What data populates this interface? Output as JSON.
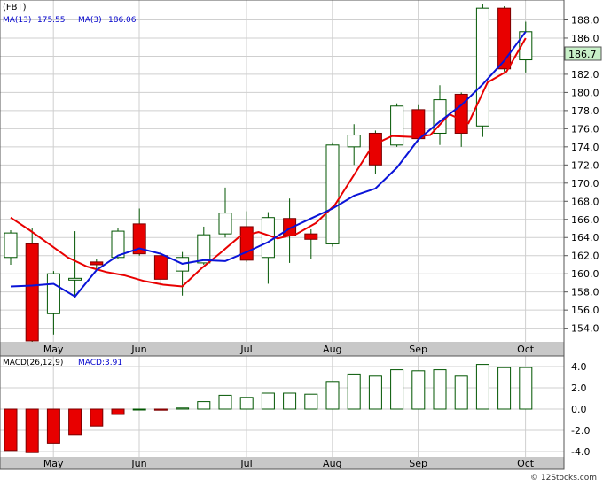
{
  "header": {
    "ticker": "(FBT)",
    "ma13_label": "MA(13)",
    "ma13_value": "175.55",
    "ma3_label": "MA(3)",
    "ma3_value": "186.06",
    "current_price": "186.7"
  },
  "macd_header": {
    "label": "MACD(26,12,9)",
    "value_label": "MACD:3.91"
  },
  "watermark": "© 12Stocks.com",
  "colors": {
    "up_candle": "#ffffff",
    "down_candle": "#e80000",
    "candle_border": "#005500",
    "ma_short": "#e80000",
    "ma_long": "#0a14d8",
    "macd_bar": "#005500",
    "axis_band": "#c8c8c8",
    "grid": "#cfcfcf",
    "price_badge": "#c8f0c8"
  },
  "chart_data": [
    {
      "type": "candlestick",
      "title": "",
      "x_labels": [
        "May",
        "Jun",
        "Jul",
        "Aug",
        "Sep",
        "Oct"
      ],
      "x_label_at_index": [
        1,
        5,
        10,
        14,
        18,
        23
      ],
      "ylim": [
        152.5,
        190
      ],
      "y_ticks": [
        "154.0",
        "156.0",
        "158.0",
        "160.0",
        "162.0",
        "164.0",
        "166.0",
        "168.0",
        "170.0",
        "172.0",
        "174.0",
        "176.0",
        "178.0",
        "180.0",
        "182.0",
        "184.0",
        "186.0",
        "188.0"
      ],
      "grid": true,
      "candles": [
        {
          "open": 161.8,
          "high": 164.8,
          "low": 161.0,
          "close": 164.5
        },
        {
          "open": 163.3,
          "high": 165.0,
          "low": 152.5,
          "close": 152.6
        },
        {
          "open": 155.6,
          "high": 160.3,
          "low": 153.3,
          "close": 160.0
        },
        {
          "open": 159.5,
          "high": 164.7,
          "low": 157.3,
          "close": 159.5
        },
        {
          "open": 161.3,
          "high": 161.6,
          "low": 160.3,
          "close": 161.0
        },
        {
          "open": 161.8,
          "high": 165.0,
          "low": 161.6,
          "close": 164.7
        },
        {
          "open": 165.5,
          "high": 167.2,
          "low": 162.0,
          "close": 162.2
        },
        {
          "open": 162.0,
          "high": 162.5,
          "low": 158.4,
          "close": 159.4
        },
        {
          "open": 160.3,
          "high": 162.4,
          "low": 157.6,
          "close": 161.8
        },
        {
          "open": 161.2,
          "high": 165.2,
          "low": 161.0,
          "close": 164.3
        },
        {
          "open": 164.4,
          "high": 169.5,
          "low": 164.0,
          "close": 166.7
        },
        {
          "open": 165.2,
          "high": 166.9,
          "low": 161.3,
          "close": 161.5
        },
        {
          "open": 161.8,
          "high": 166.8,
          "low": 158.9,
          "close": 166.2
        },
        {
          "open": 166.1,
          "high": 168.3,
          "low": 161.2,
          "close": 164.2
        },
        {
          "open": 164.4,
          "high": 164.9,
          "low": 161.6,
          "close": 163.8
        },
        {
          "open": 163.3,
          "high": 174.5,
          "low": 163.0,
          "close": 174.2
        },
        {
          "open": 174.0,
          "high": 176.5,
          "low": 172.0,
          "close": 175.3
        },
        {
          "open": 175.5,
          "high": 175.8,
          "low": 171.0,
          "close": 172.0
        },
        {
          "open": 174.2,
          "high": 178.8,
          "low": 174.0,
          "close": 178.5
        },
        {
          "open": 178.1,
          "high": 178.6,
          "low": 174.6,
          "close": 174.9
        },
        {
          "open": 175.5,
          "high": 180.8,
          "low": 174.2,
          "close": 179.2
        },
        {
          "open": 179.8,
          "high": 180.0,
          "low": 174.0,
          "close": 175.5
        },
        {
          "open": 176.3,
          "high": 189.8,
          "low": 175.1,
          "close": 189.3
        },
        {
          "open": 189.3,
          "high": 189.5,
          "low": 182.3,
          "close": 182.6
        },
        {
          "open": 183.6,
          "high": 187.8,
          "low": 182.2,
          "close": 186.7
        }
      ],
      "series": [
        {
          "name": "MA(3)",
          "color_key": "ma_short",
          "start_index": 0,
          "values": [
            166.2,
            164.8,
            163.3,
            161.8,
            160.8,
            160.2,
            159.8,
            159.2,
            158.8,
            158.6,
            160.6,
            162.3,
            164.1,
            164.6,
            163.9,
            164.4,
            165.6,
            167.6,
            170.9,
            174.2,
            175.2,
            175.1,
            175.3,
            177.6,
            176.6,
            181.1,
            182.3,
            186.0
          ]
        },
        {
          "name": "MA(13)",
          "color_key": "ma_long",
          "start_index": 0,
          "values": [
            158.6,
            158.7,
            158.9,
            157.5,
            160.4,
            162.0,
            162.8,
            162.2,
            161.1,
            161.5,
            161.4,
            162.4,
            163.5,
            165.0,
            166.1,
            167.2,
            168.6,
            169.4,
            171.7,
            174.8,
            176.8,
            178.6,
            180.9,
            183.5,
            186.7
          ]
        }
      ]
    },
    {
      "type": "bar",
      "title": "MACD(26,12,9)",
      "x_labels": [
        "May",
        "Jun",
        "Jul",
        "Aug",
        "Sep",
        "Oct"
      ],
      "ylim": [
        -4.5,
        5.0
      ],
      "y_ticks": [
        "4.0",
        "2.0",
        "0.0",
        "-2.0",
        "-4.0"
      ],
      "values": [
        -3.9,
        -4.1,
        -3.2,
        -2.4,
        -1.6,
        -0.5,
        0.0,
        -0.1,
        0.1,
        0.7,
        1.3,
        1.1,
        1.5,
        1.5,
        1.4,
        2.6,
        3.3,
        3.1,
        3.7,
        3.6,
        3.7,
        3.1,
        4.2,
        3.9,
        3.91
      ]
    }
  ]
}
